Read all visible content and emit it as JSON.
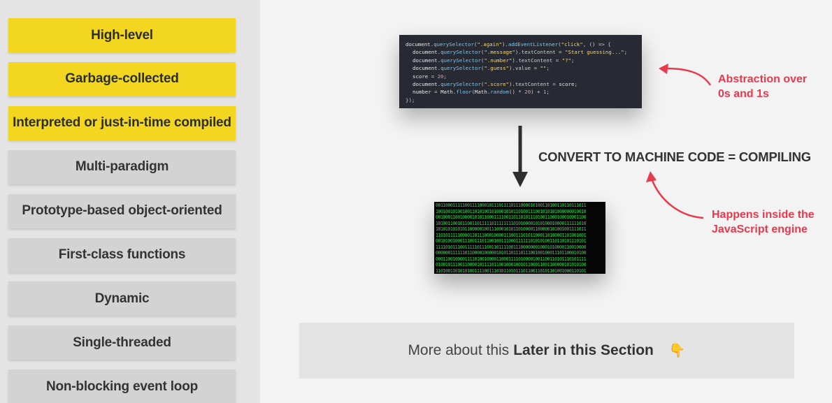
{
  "features": [
    {
      "label": "High-level",
      "highlighted": true
    },
    {
      "label": "Garbage-collected",
      "highlighted": true
    },
    {
      "label": "Interpreted or just-in-time compiled",
      "highlighted": true
    },
    {
      "label": "Multi-paradigm",
      "highlighted": false
    },
    {
      "label": "Prototype-based object-oriented",
      "highlighted": false
    },
    {
      "label": "First-class functions",
      "highlighted": false
    },
    {
      "label": "Dynamic",
      "highlighted": false
    },
    {
      "label": "Single-threaded",
      "highlighted": false
    },
    {
      "label": "Non-blocking event loop",
      "highlighted": false
    }
  ],
  "code": {
    "lines": [
      "document.querySelector(\".again\").addEventListener(\"click\", () => {",
      "document.querySelector(\".message\").textContent = \"Start guessing...\";",
      "document.querySelector(\".number\").textContent = \"?\";",
      "document.querySelector(\".guess\").value = \"\";",
      "score = 20;",
      "document.querySelector(\".score\").textContent = score;",
      "number = Math.floor(Math.random() * 20) + 1;",
      "});"
    ]
  },
  "compile_label": "CONVERT TO MACHINE CODE = COMPILING",
  "annotations": {
    "abstraction": [
      "Abstraction over",
      "0s and 1s"
    ],
    "engine": [
      "Happens inside the",
      "JavaScript engine"
    ]
  },
  "note": {
    "prefix": "More about this",
    "bold": "Later in this Section",
    "emoji": "👇"
  },
  "colors": {
    "highlight": "#f2d61f",
    "feature_bg": "#d3d3d3",
    "annotation": "#e8394d",
    "binary": "#2bd84a",
    "code_bg": "#272a33"
  },
  "icons": [
    "down-arrow-icon",
    "curved-arrow-icon",
    "pointing-down-emoji-icon"
  ]
}
